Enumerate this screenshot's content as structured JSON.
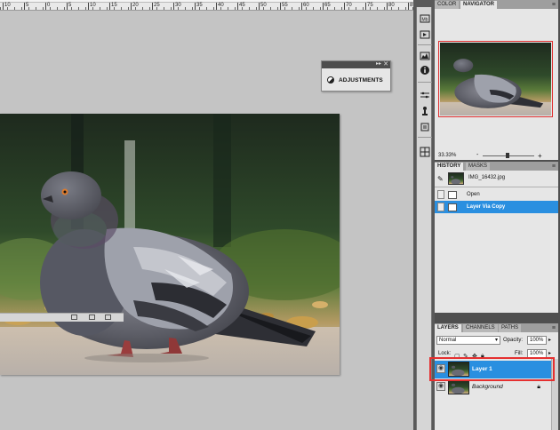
{
  "ruler": {
    "labels": [
      "10",
      "5",
      "0",
      "5",
      "10",
      "15",
      "20",
      "25",
      "30",
      "35",
      "40",
      "45",
      "50",
      "55",
      "60",
      "65",
      "70",
      "75",
      "80",
      "85"
    ]
  },
  "adjustments": {
    "title": "ADJUSTMENTS",
    "double_arrow": "▸▸",
    "close": "✕"
  },
  "dock": {
    "icons": [
      "mini-bridge-icon",
      "actions-icon",
      "histogram-icon",
      "info-icon",
      "brush-presets-icon",
      "clone-source-icon",
      "notes-icon",
      "layer-comps-icon"
    ]
  },
  "navigator": {
    "tabs": [
      "COLOR",
      "NAVIGATOR"
    ],
    "active_tab": "NAVIGATOR",
    "zoom": "33.33%",
    "minus": "-",
    "plus": "+"
  },
  "history": {
    "tabs": [
      "HISTORY",
      "MASKS"
    ],
    "active_tab": "HISTORY",
    "snapshot": "IMG_16432.jpg",
    "steps": [
      {
        "label": "Open",
        "selected": false
      },
      {
        "label": "Layer Via Copy",
        "selected": true
      }
    ]
  },
  "layers": {
    "tabs": [
      "LAYERS",
      "CHANNELS",
      "PATHS"
    ],
    "active_tab": "LAYERS",
    "blend_mode": "Normal",
    "opacity_label": "Opacity:",
    "opacity_value": "100%",
    "lock_label": "Lock:",
    "fill_label": "Fill:",
    "fill_value": "100%",
    "items": [
      {
        "name": "Layer 1",
        "selected": true,
        "visible": true
      },
      {
        "name": "Background",
        "selected": false,
        "visible": true
      }
    ]
  },
  "colors": {
    "accent": "#2a8fe0",
    "highlight": "#e53030",
    "panel_bg": "#e6e6e6",
    "dock_bg": "#5a5a5a"
  }
}
